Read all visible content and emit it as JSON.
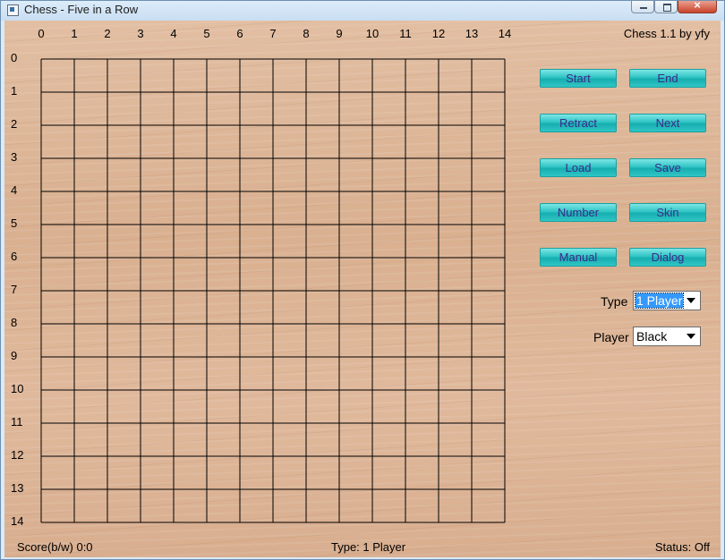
{
  "window": {
    "title": "Chess - Five in a Row",
    "app_icon": "window-app-icon"
  },
  "board": {
    "size": 15,
    "column_labels": [
      "0",
      "1",
      "2",
      "3",
      "4",
      "5",
      "6",
      "7",
      "8",
      "9",
      "10",
      "11",
      "12",
      "13",
      "14"
    ],
    "row_labels": [
      "0",
      "1",
      "2",
      "3",
      "4",
      "5",
      "6",
      "7",
      "8",
      "9",
      "10",
      "11",
      "12",
      "13",
      "14"
    ],
    "line_color": "#000000",
    "stones": []
  },
  "version": "Chess 1.1 by yfy",
  "buttons": {
    "start": "Start",
    "end": "End",
    "retract": "Retract",
    "next": "Next",
    "load": "Load",
    "save": "Save",
    "number": "Number",
    "skin": "Skin",
    "manual": "Manual",
    "dialog": "Dialog"
  },
  "controls": {
    "type_label": "Type",
    "type_value": "1 Player",
    "player_label": "Player",
    "player_value": "Black"
  },
  "status_bar": {
    "score": "Score(b/w) 0:0",
    "type": "Type: 1 Player",
    "status": "Status: Off"
  },
  "colors": {
    "button_teal": "#2fc4c4",
    "button_text": "#3b2a8a",
    "wood": "#ddb596"
  }
}
